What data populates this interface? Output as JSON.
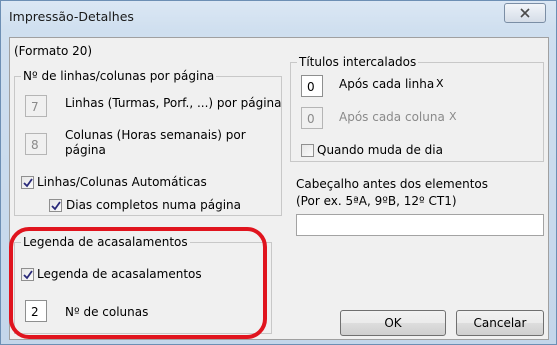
{
  "window": {
    "title": "Impressão-Detalhes",
    "close_symbol": "X"
  },
  "format_label": "(Formato 20)",
  "lines_group": {
    "legend": "Nº de linhas/colunas por página",
    "lines_value": "7",
    "lines_label": "Linhas (Turmas, Porf., ...) por página",
    "columns_value": "8",
    "columns_label_1": "Colunas (Horas semanais) por",
    "columns_label_2": "página",
    "auto_label": "Linhas/Colunas Automáticas",
    "auto_checked": true,
    "fullday_label": "Dias completos numa página",
    "fullday_checked": true
  },
  "legend_group": {
    "legend": "Legenda de acasalamentos",
    "check_label": "Legenda de acasalamentos",
    "check_checked": true,
    "columns_value": "2",
    "columns_label": "Nº de colunas"
  },
  "titles_group": {
    "legend": "Títulos intercalados",
    "after_line_value": "0",
    "after_line_label": "Após cada linha",
    "after_column_value": "0",
    "after_column_label": "Após cada coluna",
    "x_mark": "X",
    "day_change_label": "Quando muda de dia",
    "day_change_checked": false
  },
  "header": {
    "label_1": "Cabeçalho antes dos elementos",
    "label_2": "(Por ex. 5ªA, 9ºB, 12º CT1)",
    "value": ""
  },
  "buttons": {
    "ok": "OK",
    "cancel": "Cancelar"
  },
  "colors": {
    "highlight": "#e0141e"
  }
}
